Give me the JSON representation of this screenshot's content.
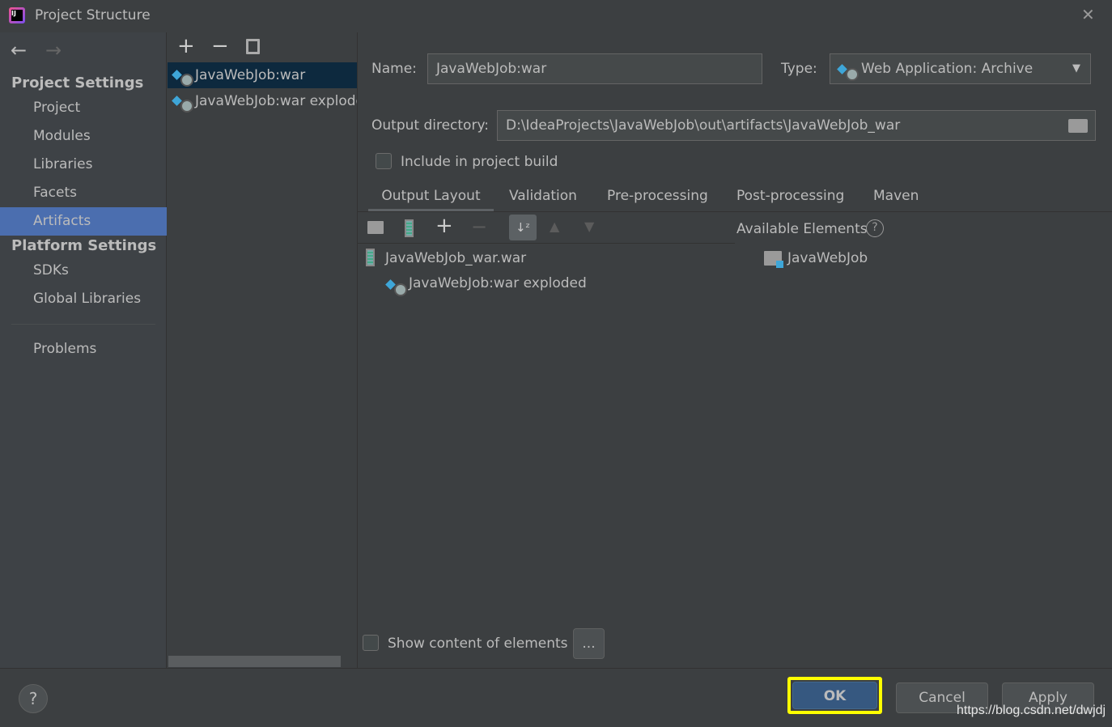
{
  "window": {
    "title": "Project Structure"
  },
  "sidebar": {
    "project_settings_heading": "Project Settings",
    "project_items": [
      {
        "label": "Project"
      },
      {
        "label": "Modules"
      },
      {
        "label": "Libraries"
      },
      {
        "label": "Facets"
      },
      {
        "label": "Artifacts",
        "selected": true
      }
    ],
    "platform_settings_heading": "Platform Settings",
    "platform_items": [
      {
        "label": "SDKs"
      },
      {
        "label": "Global Libraries"
      }
    ],
    "problems": "Problems"
  },
  "artifacts_list": {
    "items": [
      {
        "label": "JavaWebJob:war",
        "selected": true
      },
      {
        "label": "JavaWebJob:war exploded"
      }
    ]
  },
  "form": {
    "name_label": "Name:",
    "name_value": "JavaWebJob:war",
    "type_label": "Type:",
    "type_value": "Web Application: Archive",
    "output_label": "Output directory:",
    "output_value": "D:\\IdeaProjects\\JavaWebJob\\out\\artifacts\\JavaWebJob_war",
    "include_label": "Include in project build",
    "include_checked": false
  },
  "tabs": [
    {
      "label": "Output Layout",
      "active": true
    },
    {
      "label": "Validation"
    },
    {
      "label": "Pre-processing"
    },
    {
      "label": "Post-processing"
    },
    {
      "label": "Maven"
    }
  ],
  "layout_tree": {
    "root": "JavaWebJob_war.war",
    "child": "JavaWebJob:war exploded"
  },
  "available": {
    "heading": "Available Elements",
    "items": [
      "JavaWebJob"
    ]
  },
  "show_content": {
    "label": "Show content of elements",
    "checked": false,
    "button": "..."
  },
  "footer": {
    "help": "?",
    "ok": "OK",
    "cancel": "Cancel",
    "apply": "Apply"
  },
  "watermark": "https://blog.csdn.net/dwjdj",
  "colors": {
    "selection": "#4b6eaf",
    "list_selection": "#0d293e",
    "highlight": "#ffff00"
  }
}
